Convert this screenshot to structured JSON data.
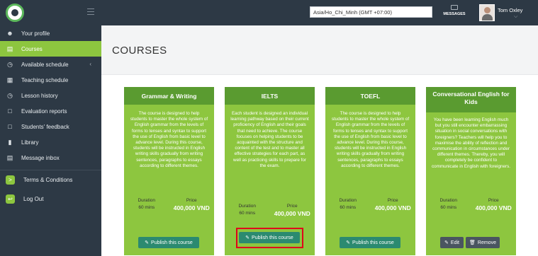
{
  "brand": {
    "logo_text": "e"
  },
  "sidebar": {
    "items": [
      {
        "label": "Your profile",
        "icon": "user-icon"
      },
      {
        "label": "Courses",
        "icon": "book-icon",
        "active": true
      },
      {
        "label": "Available schedule",
        "icon": "clock-icon",
        "chevron": "‹"
      },
      {
        "label": "Teaching schedule",
        "icon": "calendar-icon"
      },
      {
        "label": "Lesson history",
        "icon": "history-icon"
      },
      {
        "label": "Evaluation reports",
        "icon": "document-icon"
      },
      {
        "label": "Students' feedback",
        "icon": "feedback-icon"
      },
      {
        "label": "Library",
        "icon": "library-icon"
      },
      {
        "label": "Message inbox",
        "icon": "inbox-icon"
      }
    ],
    "bottom": [
      {
        "label": "Terms & Conditions",
        "icon": "terminal-icon"
      },
      {
        "label": "Log Out",
        "icon": "logout-icon"
      }
    ]
  },
  "topbar": {
    "timezone": "Asia/Ho_Chi_Minh (GMT +07:00)",
    "messages_label": "MESSAGES",
    "user_name": "Tom Oxley",
    "user_chevron": "⌵"
  },
  "page": {
    "title": "COURSES"
  },
  "labels": {
    "duration": "Duration",
    "price": "Price"
  },
  "cards": [
    {
      "title": "Grammar & Writing",
      "description": "The course is designed to help students to master the whole system of English grammar from the levels of forms to tenses and syntax to support the use of English from basic level to advance level. During this course, students will be instructed in English writing skills gradually from writing sentences, paragraphs to essays according to different themes.",
      "duration": "60 mins",
      "price": "400,000 VND",
      "button": "Publish this course"
    },
    {
      "title": "IELTS",
      "description": "Each student is designed an individual learning pathway based on their current proficiency of English and their goals that need to achieve. The course focuses on helping students to be acquainted with the structure and content of the test and to master all effective strategies for each part, as well as practicing skills to prepare for the exam.",
      "duration": "60 mins",
      "price": "400,000 VND",
      "button": "Publish this course"
    },
    {
      "title": "TOEFL",
      "description": "The course is designed to help students to master the whole system of English grammar from the levels of forms to tenses and syntax to support the use of English from basic level to advance level. During this course, students will be instructed in English writing skills gradually from writing sentences, paragraphs to essays according to different themes.",
      "duration": "60 mins",
      "price": "400,000 VND",
      "button": "Publish this course"
    },
    {
      "title": "Conversational English for Kids",
      "description": "You have been learning English much but you still encounter embarrassing situation in social conversations with foreigners? Teachers will help you to maximise the ability of reflection and communication in circumstances under different themes. Thereby, you will completely be confident to communicate in English with foreigners.",
      "duration": "60 mins",
      "price": "400,000 VND",
      "edit": "Edit",
      "remove": "Remove"
    }
  ],
  "colors": {
    "sidebar": "#2d3945",
    "accent": "#8dc63f",
    "card_head": "#5a9b30",
    "button": "#2b8a70",
    "highlight": "#e0001a"
  }
}
